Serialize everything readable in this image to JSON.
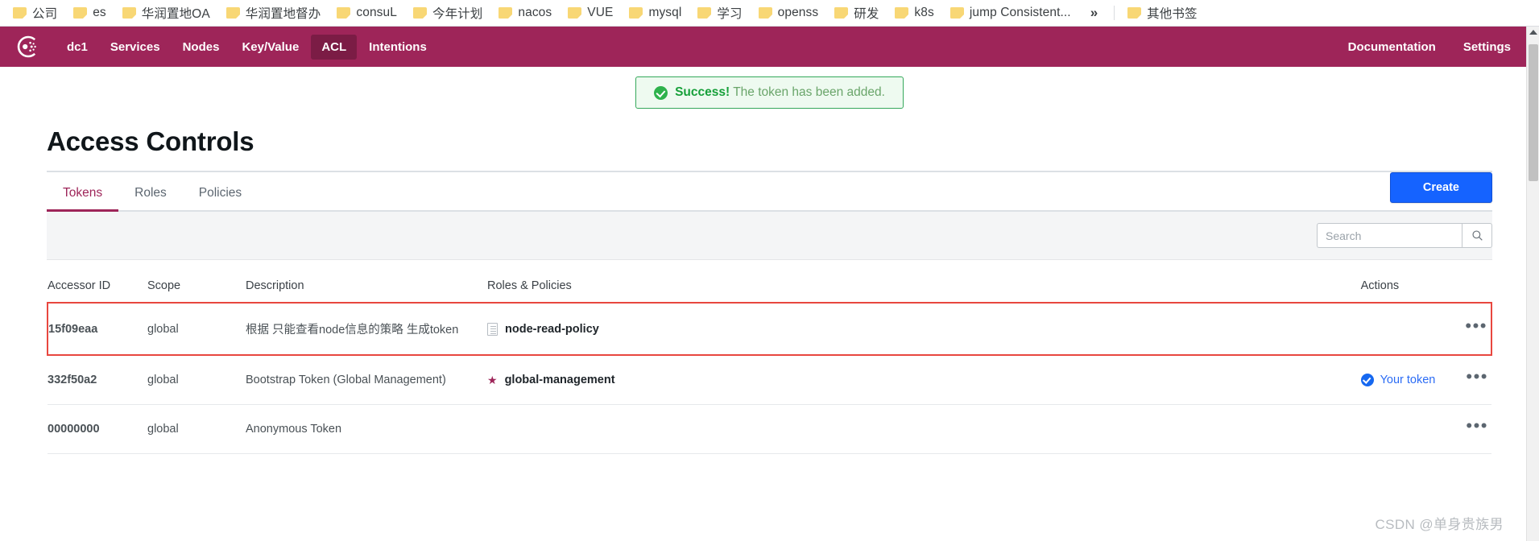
{
  "bookmarks": {
    "items": [
      {
        "label": "公司",
        "icon": "folder-icon"
      },
      {
        "label": "es",
        "icon": "folder-icon"
      },
      {
        "label": "华润置地OA",
        "icon": "folder-icon"
      },
      {
        "label": "华润置地督办",
        "icon": "folder-icon"
      },
      {
        "label": "consuL",
        "icon": "folder-icon"
      },
      {
        "label": "今年计划",
        "icon": "folder-icon"
      },
      {
        "label": "nacos",
        "icon": "folder-icon"
      },
      {
        "label": "VUE",
        "icon": "folder-icon"
      },
      {
        "label": "mysql",
        "icon": "folder-icon"
      },
      {
        "label": "学习",
        "icon": "folder-icon"
      },
      {
        "label": "openss",
        "icon": "folder-icon"
      },
      {
        "label": "研发",
        "icon": "folder-icon"
      },
      {
        "label": "k8s",
        "icon": "folder-icon"
      },
      {
        "label": "jump Consistent...",
        "icon": "folder-icon"
      }
    ],
    "overflow_label": "»",
    "other_bookmarks": {
      "label": "其他书签",
      "icon": "folder-icon"
    }
  },
  "navbar": {
    "logo": "consul-logo",
    "items": [
      {
        "label": "dc1",
        "active": false
      },
      {
        "label": "Services",
        "active": false
      },
      {
        "label": "Nodes",
        "active": false
      },
      {
        "label": "Key/Value",
        "active": false
      },
      {
        "label": "ACL",
        "active": true
      },
      {
        "label": "Intentions",
        "active": false
      }
    ],
    "right_items": [
      {
        "label": "Documentation"
      },
      {
        "label": "Settings"
      }
    ],
    "background": "#9e2559",
    "active_background": "#7b1c45"
  },
  "notification": {
    "icon": "success-check-icon",
    "strong": "Success!",
    "message": "The token has been added.",
    "border_color": "#35a85b",
    "background": "#eefaf0"
  },
  "page": {
    "title": "Access Controls"
  },
  "tabs": [
    {
      "label": "Tokens",
      "active": true
    },
    {
      "label": "Roles",
      "active": false
    },
    {
      "label": "Policies",
      "active": false
    }
  ],
  "toolbar": {
    "create_label": "Create",
    "create_color": "#1563ff"
  },
  "search": {
    "value": "",
    "placeholder": "Search",
    "icon": "search-icon"
  },
  "table": {
    "columns": [
      "Accessor ID",
      "Scope",
      "Description",
      "Roles & Policies",
      "Actions"
    ],
    "rows": [
      {
        "accessor_id": "15f09eaa",
        "scope": "global",
        "description": "根据 只能查看node信息的策略 生成token",
        "role_icon": "policy-document-icon",
        "role_label": "node-read-policy",
        "your_token": "",
        "kebab": "•••",
        "highlighted": true
      },
      {
        "accessor_id": "332f50a2",
        "scope": "global",
        "description": "Bootstrap Token (Global Management)",
        "role_icon": "star-icon",
        "role_label": "global-management",
        "your_token": "Your token",
        "kebab": "•••",
        "highlighted": false
      },
      {
        "accessor_id": "00000000",
        "scope": "global",
        "description": "Anonymous Token",
        "role_icon": "",
        "role_label": "",
        "your_token": "",
        "kebab": "•••",
        "highlighted": false
      }
    ],
    "highlight_color": "#e8473f"
  },
  "watermark": "CSDN @单身贵族男"
}
